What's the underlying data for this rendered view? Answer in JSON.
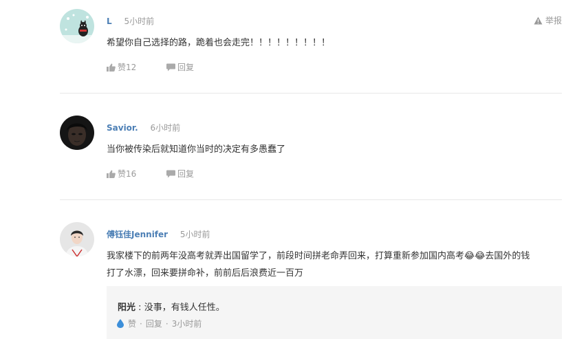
{
  "report_label": "举报",
  "comments": [
    {
      "user": "L",
      "time": "5小时前",
      "text": "希望你自己选择的路，跪着也会走完！！！！！！！！！",
      "likes": "赞12",
      "reply": "回复"
    },
    {
      "user": "Savior.",
      "time": "6小时前",
      "text": "当你被传染后就知道你当时的决定有多愚蠢了",
      "likes": "赞16",
      "reply": "回复"
    },
    {
      "user": "傅钰佳Jennifer",
      "time": "5小时前",
      "text_line1": "我家楼下的前两年没高考就弄出国留学了，前段时间拼老命弄回来，打算重新参加国内高考😂😂去国外的钱",
      "text_line2": "打了水漂，回来要拼命补，前前后后浪费近一百万",
      "nested_reply": {
        "user": "阳光",
        "colon": ":",
        "text": "没事，有钱人任性。",
        "like": "赞",
        "reply": "回复",
        "time": "3小时前",
        "dot": "·"
      }
    }
  ]
}
